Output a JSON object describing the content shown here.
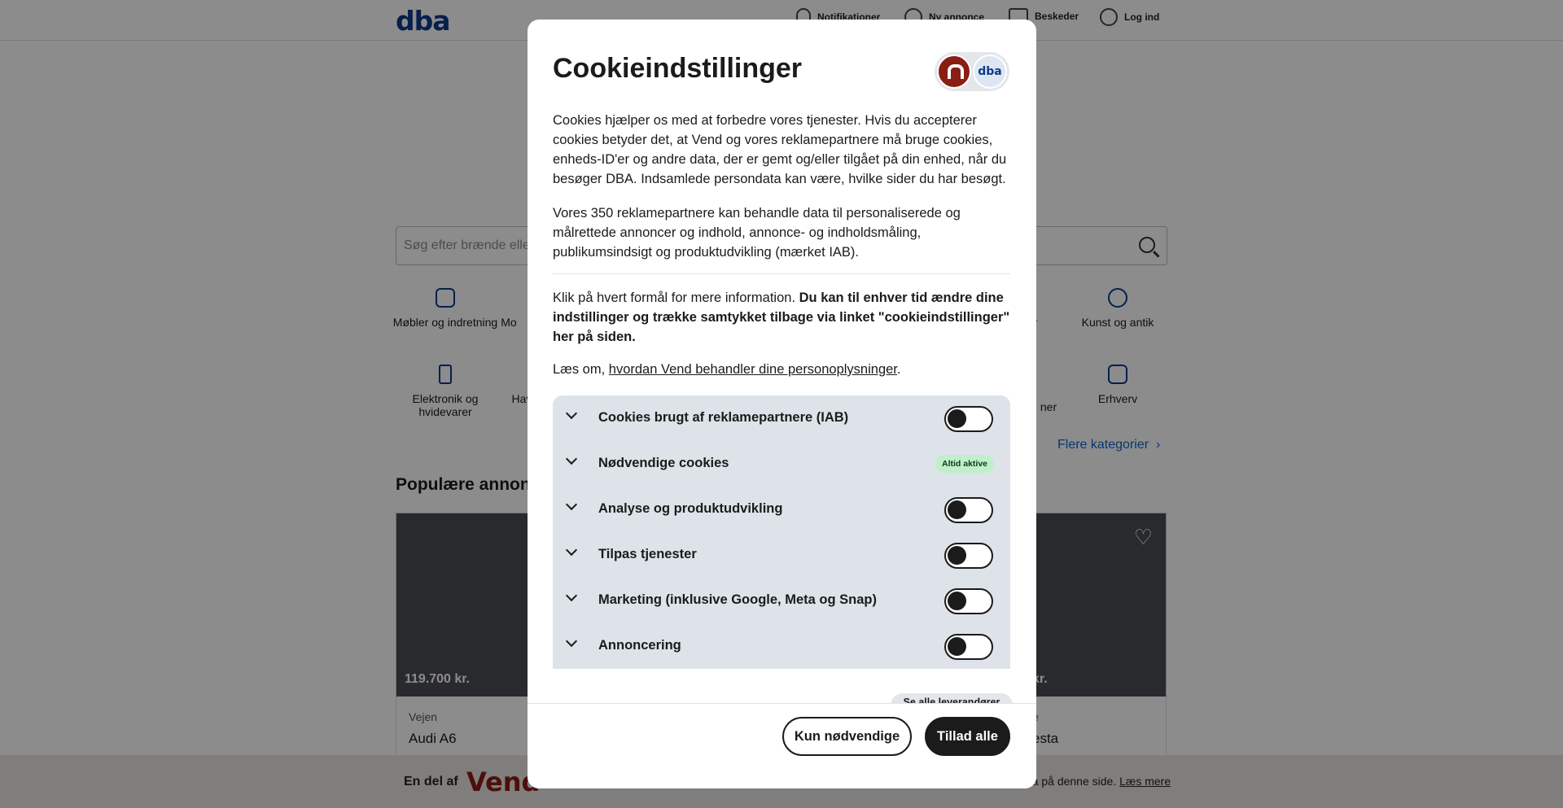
{
  "header": {
    "logo": "dba",
    "nav": [
      {
        "label": "Notifikationer",
        "icon": "bell-icon"
      },
      {
        "label": "Ny annonce",
        "icon": "plus-circle-icon"
      },
      {
        "label": "Beskeder",
        "icon": "chat-icon"
      },
      {
        "label": "Log ind",
        "icon": "user-icon"
      }
    ]
  },
  "search": {
    "placeholder": "Søg efter brænde eller..."
  },
  "categories": [
    {
      "label": "Møbler og indretning",
      "icon": "sofa-icon"
    },
    {
      "label": "Mo",
      "icon": "category-icon"
    },
    {
      "label": "r",
      "icon": "category-icon"
    },
    {
      "label": "Kunst og antik",
      "icon": "vase-icon"
    },
    {
      "label": "Elektronik og hvidevarer",
      "icon": "phone-icon"
    },
    {
      "label": "Hav",
      "icon": "category-icon"
    },
    {
      "label": "ner",
      "icon": "category-icon"
    },
    {
      "label": "Erhverv",
      "icon": "shop-icon"
    }
  ],
  "more_categories": "Flere kategorier",
  "popular_title": "Populære annonce",
  "listings": [
    {
      "price": "119.700 kr.",
      "location": "Vejen",
      "title": "Audi A6"
    },
    {
      "price": "kr.",
      "location": "e",
      "title": "esta"
    }
  ],
  "footer": {
    "part_of": "En del af",
    "brand": "Vend",
    "info": "ata på denne side.",
    "link": "Læs mere"
  },
  "modal": {
    "title": "Cookieindstillinger",
    "brand_badge": "dba",
    "p1": "Cookies hjælper os med at forbedre vores tjenester. Hvis du accepterer cookies betyder det, at Vend og vores reklamepartnere må bruge cookies, enheds-ID'er og andre data, der er gemt og/eller tilgået på din enhed, når du besøger DBA. Indsamlede persondata kan være, hvilke sider du har besøgt.",
    "p2": "Vores 350 reklamepartnere kan behandle data til personaliserede og målrettede annoncer og indhold, annonce- og indholdsmåling, publikumsindsigt og produktudvikling (mærket IAB).",
    "p3_plain": "Klik på hvert formål for mere information. ",
    "p3_bold": "Du kan til enhver tid ændre dine indstillinger og trække samtykket tilbage via linket \"cookieindstillinger\" her på siden.",
    "p4_prefix": "Læs om, ",
    "p4_link": "hvordan Vend behandler dine personoplysninger",
    "p4_suffix": ".",
    "purposes": [
      {
        "label": "Cookies brugt af reklamepartnere (IAB)",
        "enabled": false
      },
      {
        "label": "Nødvendige cookies",
        "badge": "Altid aktive"
      },
      {
        "label": "Analyse og produktudvikling",
        "enabled": false
      },
      {
        "label": "Tilpas tjenester",
        "enabled": false
      },
      {
        "label": "Marketing (inklusive Google, Meta og Snap)",
        "enabled": false
      },
      {
        "label": "Annoncering",
        "enabled": false
      }
    ],
    "partners_link": "Se alle leverandører",
    "btn_necessary": "Kun nødvendige",
    "btn_allow_all": "Tillad alle"
  }
}
